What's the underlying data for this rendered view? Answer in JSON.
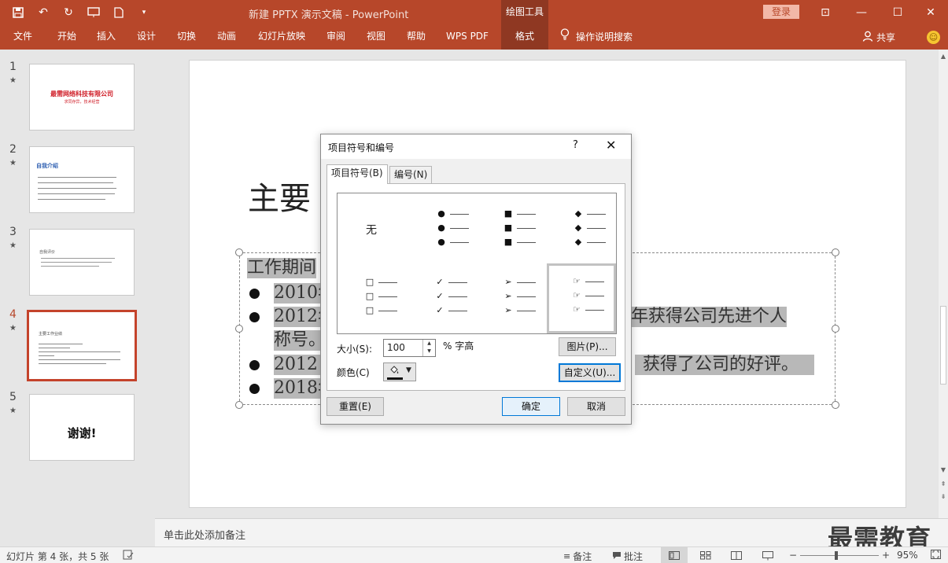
{
  "window": {
    "title": "新建 PPTX 演示文稿  -  PowerPoint",
    "context_tab_group": "绘图工具",
    "login_label": "登录",
    "controls": {
      "restore_ribbon": "⊡",
      "minimize": "—",
      "maximize": "☐",
      "close": "✕"
    }
  },
  "ribbon": {
    "tabs": [
      "文件",
      "开始",
      "插入",
      "设计",
      "切换",
      "动画",
      "幻灯片放映",
      "审阅",
      "视图",
      "帮助",
      "WPS PDF",
      "格式"
    ],
    "active_tab": "格式",
    "search_label": "操作说明搜索",
    "share_label": "共享"
  },
  "thumbnails": {
    "items": [
      {
        "number": "1",
        "title": "最需网络科技有限公司",
        "subtitle": "求同存异，技术经营"
      },
      {
        "number": "2",
        "title": "自我介绍"
      },
      {
        "number": "3",
        "title": "自我评价"
      },
      {
        "number": "4",
        "title": "主要工作业绩"
      },
      {
        "number": "5",
        "title": "谢谢!"
      }
    ],
    "active_index": 4
  },
  "slide": {
    "title": "主要",
    "lines": [
      {
        "text": "工作期间",
        "right": ""
      },
      {
        "text": "2010年",
        "right": ""
      },
      {
        "text": "2012年",
        "right": "年获得公司先进个人"
      },
      {
        "text": "称号。",
        "right": ""
      },
      {
        "text": "2012－",
        "right": "获得了公司的好评。"
      },
      {
        "text": "2018年",
        "right": ""
      }
    ]
  },
  "notes_placeholder": "单击此处添加备注",
  "watermark": "最需教育",
  "status": {
    "slide_info": "幻灯片 第 4 张，共 5 张",
    "notes_label": "备注",
    "comments_label": "批注",
    "zoom": "95%"
  },
  "dialog": {
    "title": "项目符号和编号",
    "help": "?",
    "tab_bullets": "项目符号(B)",
    "tab_numbering": "编号(N)",
    "none_label": "无",
    "bullet_styles": [
      "none",
      "filled-round",
      "filled-square",
      "diamond",
      "hollow-square",
      "checkmark",
      "arrowhead",
      "pointing-hand"
    ],
    "selected_style": "pointing-hand",
    "size_label": "大小(S):",
    "size_value": "100",
    "size_unit": "% 字高",
    "color_label": "颜色(C)",
    "picture_button": "图片(P)...",
    "custom_button": "自定义(U)...",
    "reset_button": "重置(E)",
    "ok_button": "确定",
    "cancel_button": "取消"
  }
}
